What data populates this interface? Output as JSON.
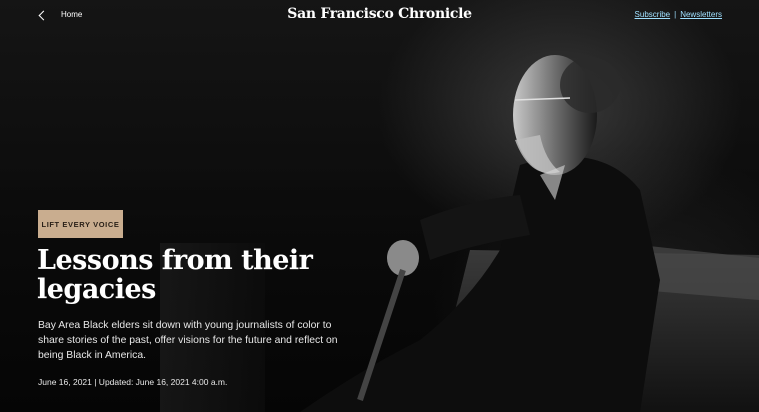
{
  "header": {
    "back_label": "",
    "home_label": "Home",
    "logo": "San Francisco Chronicle",
    "subscribe_label": "Subscribe",
    "separator": "|",
    "newsletters_label": "Newsletters",
    "link_color": "#9fe0ff"
  },
  "hero": {
    "kicker": "LIFT EVERY VOICE",
    "kicker_color": "#c9ad8f",
    "headline": "Lessons from their legacies",
    "dek": "Bay Area Black elders sit down with young journalists of color to share stories of the past, offer visions for the future and reflect on being Black in America.",
    "dateline": "June 16, 2021 | Updated: June 16, 2021 4:00 a.m."
  },
  "photo": {
    "subject": "elderly man seated holding a cane, black and white portrait"
  }
}
